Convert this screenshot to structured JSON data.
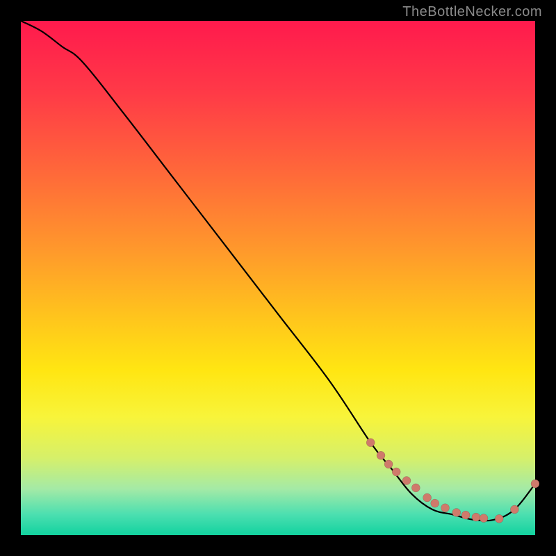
{
  "watermark": {
    "text": "TheBottleNecker.com"
  },
  "colors": {
    "page_bg": "#000000",
    "curve": "#000000",
    "marker": "#cf7a6b",
    "gradient_stops": [
      "#ff1a4d",
      "#ff3a47",
      "#ff6a39",
      "#ff9a2b",
      "#ffc61c",
      "#ffe612",
      "#f8f43a",
      "#d6f06a",
      "#a4eaa6",
      "#4bdfb0",
      "#12d29f"
    ]
  },
  "chart_data": {
    "type": "line",
    "title": "",
    "xlabel": "",
    "ylabel": "",
    "xlim": [
      0,
      100
    ],
    "ylim": [
      0,
      100
    ],
    "series": [
      {
        "name": "bottleneck-curve",
        "x": [
          0,
          4,
          8,
          12,
          20,
          30,
          40,
          50,
          60,
          68,
          72,
          76,
          80,
          84,
          88,
          92,
          96,
          100
        ],
        "y": [
          100,
          98,
          95,
          92,
          82,
          69,
          56,
          43,
          30,
          18,
          13,
          8,
          5,
          4,
          3,
          3,
          5,
          10
        ]
      }
    ],
    "markers": {
      "name": "highlight-points",
      "x": [
        68,
        70,
        71.5,
        73,
        75,
        76.8,
        79,
        80.5,
        82.5,
        84.7,
        86.5,
        88.5,
        90,
        93,
        96,
        100
      ],
      "y": [
        18,
        15.5,
        13.8,
        12.3,
        10.6,
        9.2,
        7.3,
        6.2,
        5.3,
        4.4,
        3.9,
        3.5,
        3.3,
        3.2,
        5.0,
        10
      ]
    }
  }
}
